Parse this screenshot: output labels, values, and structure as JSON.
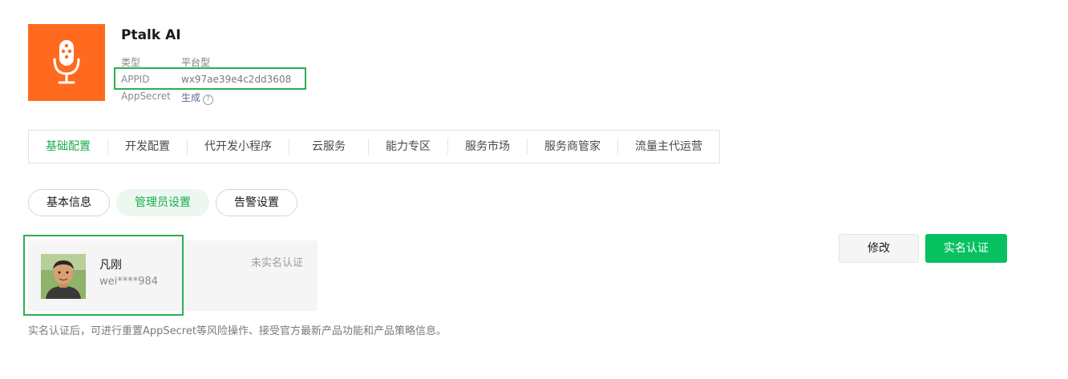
{
  "app": {
    "name": "Ptalk AI",
    "icon": "microphone-icon",
    "brand_color": "#ff6a1f"
  },
  "meta": {
    "type_label": "类型",
    "type_value": "平台型",
    "appid_label": "APPID",
    "appid_value": "wx97ae39e4c2dd3608",
    "secret_label": "AppSecret",
    "secret_action": "生成",
    "help_glyph": "?"
  },
  "tabs": [
    {
      "label": "基础配置",
      "active": true
    },
    {
      "label": "开发配置",
      "active": false
    },
    {
      "label": "代开发小程序",
      "active": false
    },
    {
      "label": "云服务",
      "active": false
    },
    {
      "label": "能力专区",
      "active": false
    },
    {
      "label": "服务市场",
      "active": false
    },
    {
      "label": "服务商管家",
      "active": false
    },
    {
      "label": "流量主代运营",
      "active": false
    }
  ],
  "subtabs": {
    "basic_info": "基本信息",
    "admin_settings": "管理员设置",
    "alert_settings": "告警设置"
  },
  "admin": {
    "name": "凡刚",
    "wechat_id": "wei****984",
    "status": "未实名认证"
  },
  "actions": {
    "modify": "修改",
    "verify": "实名认证"
  },
  "notice": "实名认证后，可进行重置AppSecret等风险操作、接受官方最新产品功能和产品策略信息。",
  "colors": {
    "accent_green": "#07c160",
    "highlight_green": "#2dae4f",
    "active_tab": "#1aad4f"
  }
}
